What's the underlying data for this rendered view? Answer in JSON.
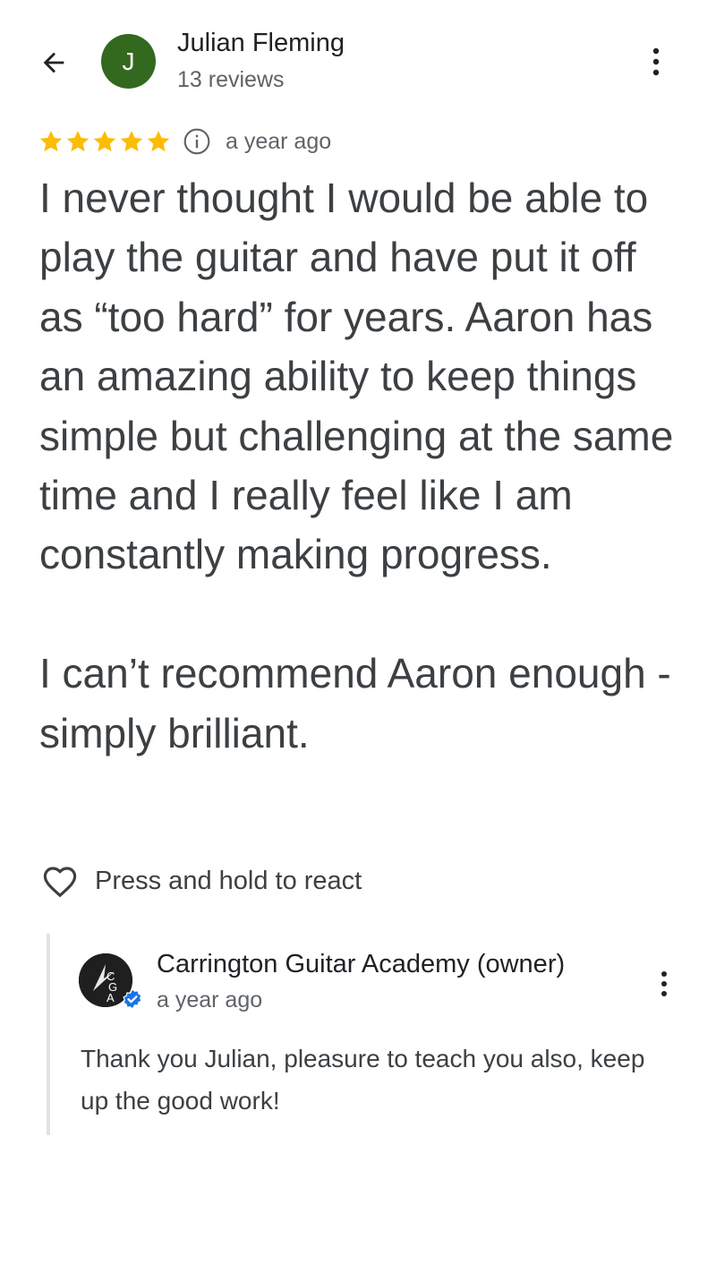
{
  "reviewer": {
    "name": "Julian Fleming",
    "initial": "J",
    "review_count": "13 reviews"
  },
  "review": {
    "rating": 5,
    "max_rating": 5,
    "time": "a year ago",
    "text": "I never thought I would be able to play the guitar and have put it off as “too hard” for years. Aaron has an amazing ability to keep things simple but challenging at the same time and I really feel like I am constantly making progress.\n\nI can’t recommend Aaron enough - simply brilliant."
  },
  "reaction": {
    "label": "Press and hold to react"
  },
  "owner_reply": {
    "name": "Carrington Guitar Academy (owner)",
    "time": "a year ago",
    "text": "Thank you Julian, pleasure to teach you also, keep up the good work!"
  },
  "icons": {
    "back": "arrow-back-icon",
    "more": "more-vert-icon",
    "star": "star-icon",
    "info": "info-icon",
    "heart": "heart-outline-icon",
    "verified": "verified-check-icon"
  },
  "colors": {
    "star": "#fbbc04",
    "avatar_bg": "#33691e",
    "verified": "#1a73e8",
    "text_primary": "#202124",
    "text_body": "#3c4043",
    "text_secondary": "#5f6368",
    "reply_border": "#e3e3e3"
  }
}
